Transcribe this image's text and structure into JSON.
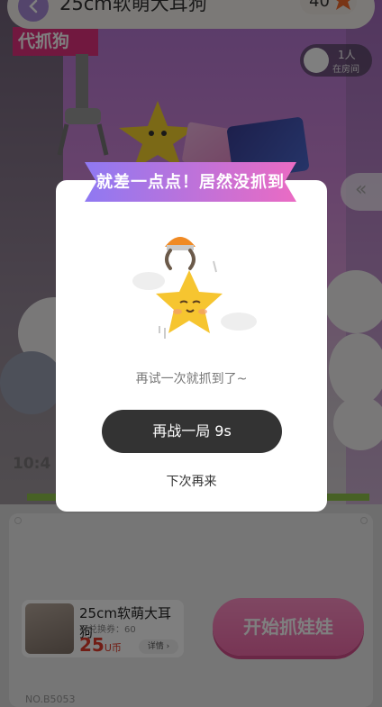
{
  "header": {
    "title": "25cm软萌大耳狗",
    "coin_balance": "40"
  },
  "room": {
    "count": "1人",
    "label": "在房间"
  },
  "side_tab": {
    "glyph": "«"
  },
  "scene": {
    "sign_text": "代抓狗",
    "overlay_text": "10:4"
  },
  "prize": {
    "name": "25cm软萌大耳狗",
    "exchange": "可兑换券：60",
    "price": "25",
    "price_unit": "U币",
    "detail_label": "详情 ›"
  },
  "start_button": "开始抓娃娃",
  "machine_no": "NO.B5053",
  "dialog": {
    "ribbon_title": "就差一点点！居然没抓到",
    "message": "再试一次就抓到了~",
    "retry_label": "再战一局 9s",
    "later_label": "下次再来"
  },
  "colors": {
    "accent_pink": "#f06aa9",
    "ribbon_start": "#8f79f2",
    "ribbon_end": "#ea6bc3",
    "price_red": "#e23b2a"
  }
}
